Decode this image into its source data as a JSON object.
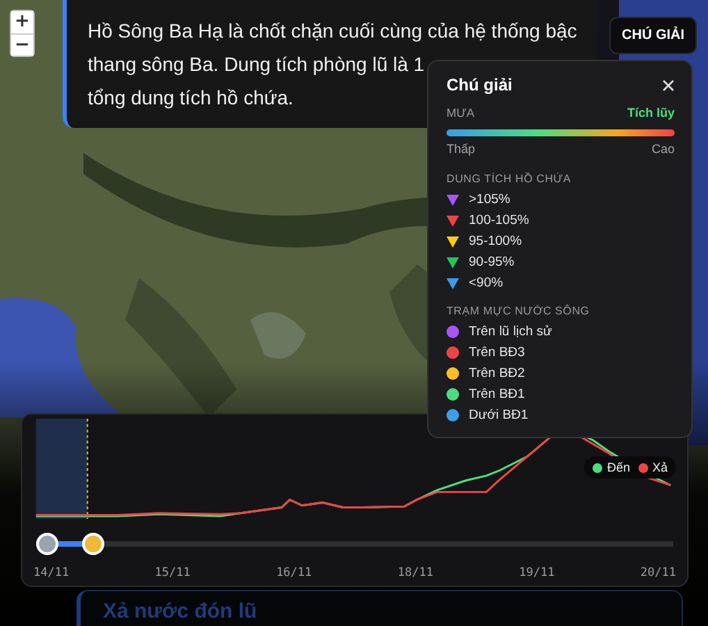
{
  "map_controls": [
    {
      "label": "+"
    },
    {
      "label": "−"
    }
  ],
  "story": {
    "lines": [
      "Hồ Sông Ba Hạ là chốt chặn cuối cùng của hệ thống bậc",
      "thang sông Ba. Dung tích phòng lũ là 1",
      "tổng dung tích hồ chứa."
    ]
  },
  "legend_button": {
    "label": "CHÚ GIẢI"
  },
  "legend": {
    "title": "Chú giải",
    "rain": {
      "label": "MƯA",
      "mode": "Tích lũy",
      "low": "Thấp",
      "high": "Cao"
    },
    "reservoir": {
      "heading": "DUNG TÍCH HỒ CHỨA",
      "items": [
        {
          "label": ">105%",
          "color": "#a855f7"
        },
        {
          "label": "100-105%",
          "color": "#ef4444"
        },
        {
          "label": "95-100%",
          "color": "#facc15"
        },
        {
          "label": "90-95%",
          "color": "#22c55e"
        },
        {
          "label": "<90%",
          "color": "#3b9be8"
        }
      ]
    },
    "stations": {
      "heading": "TRẠM MỰC NƯỚC SÔNG",
      "items": [
        {
          "label": "Trên lũ lịch sử",
          "color": "#a855f7"
        },
        {
          "label": "Trên BĐ3",
          "color": "#ef4444"
        },
        {
          "label": "Trên BĐ2",
          "color": "#fbbf24"
        },
        {
          "label": "Trên BĐ1",
          "color": "#4ade80"
        },
        {
          "label": "Dưới BĐ1",
          "color": "#3ba0ea"
        }
      ]
    }
  },
  "chart": {
    "series": [
      {
        "name": "Đến",
        "color": "#4ade80"
      },
      {
        "name": "Xả",
        "color": "#ef4444"
      }
    ],
    "dates": [
      "14/11",
      "15/11",
      "16/11",
      "18/11",
      "19/11",
      "20/11"
    ],
    "timeline": {
      "level": 0.09
    }
  },
  "next_story": {
    "title": "Xả nước đón lũ"
  }
}
